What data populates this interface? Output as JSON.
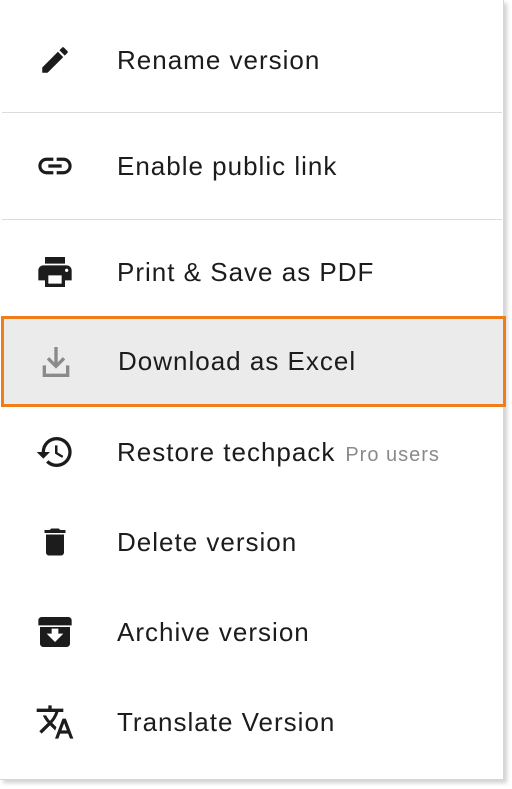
{
  "menu": {
    "items": [
      {
        "label": "Rename version",
        "icon": "pencil-icon"
      },
      {
        "label": "Enable public link",
        "icon": "link-icon"
      },
      {
        "label": "Print & Save as PDF",
        "icon": "print-icon"
      },
      {
        "label": "Download as Excel",
        "icon": "download-icon",
        "highlighted": true
      },
      {
        "label": "Restore techpack",
        "icon": "history-icon",
        "tag": "Pro users"
      },
      {
        "label": "Delete version",
        "icon": "trash-icon"
      },
      {
        "label": "Archive version",
        "icon": "archive-icon"
      },
      {
        "label": "Translate Version",
        "icon": "translate-icon"
      }
    ]
  },
  "colors": {
    "highlight_border": "#ef7d1a",
    "highlight_bg": "#ebebeb",
    "text": "#1c1c1c",
    "muted": "#8a8a8a"
  }
}
